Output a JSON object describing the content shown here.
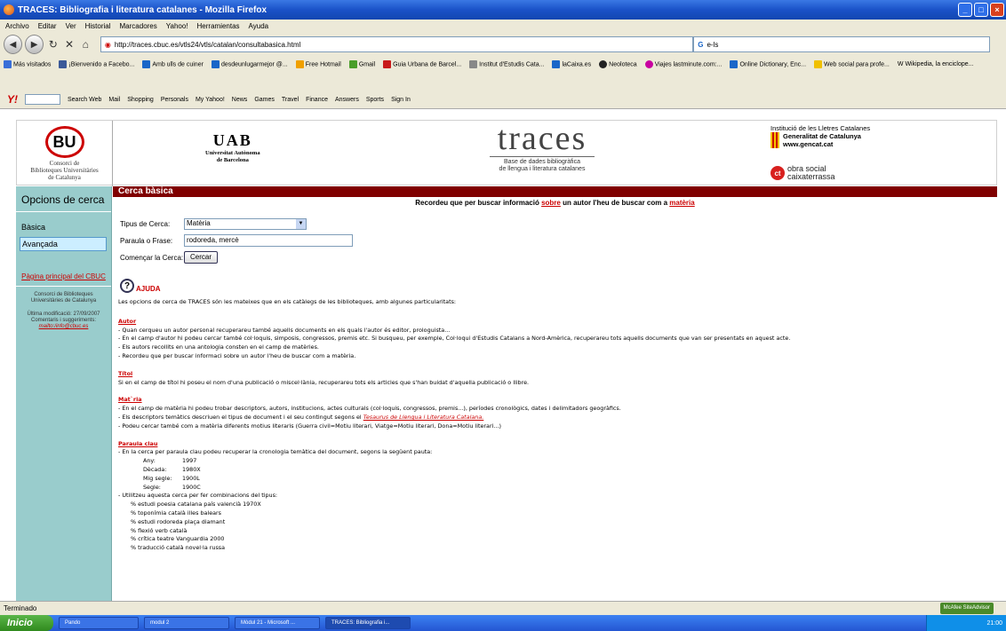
{
  "window": {
    "title": "TRACES: Bibliografia i literatura catalanes - Mozilla Firefox",
    "controls": [
      "_",
      "□",
      "×"
    ]
  },
  "menu": [
    "Archivo",
    "Editar",
    "Ver",
    "Historial",
    "Marcadores",
    "Yahoo!",
    "Herramientas",
    "Ayuda"
  ],
  "nav": {
    "url": "http://traces.cbuc.es/vtls24/vtls/catalan/consultabasica.html",
    "search_value": "e-ls"
  },
  "bookmarks": [
    {
      "label": "Más visitados",
      "color": "#3a6fd8"
    },
    {
      "label": "¡Bienvenido a Facebo...",
      "color": "#3b5998"
    },
    {
      "label": "Amb ulls de cuiner",
      "color": "#1a66c8"
    },
    {
      "label": "desdeunlugarmejor @...",
      "color": "#1a66c8"
    },
    {
      "label": "Free Hotmail",
      "color": "#f0a000"
    },
    {
      "label": "Gmail",
      "color": "#4a9e2a"
    },
    {
      "label": "Guia Urbana de Barcel...",
      "color": "#c81a1a"
    },
    {
      "label": "Institut d'Estudis Cata...",
      "color": "#888888"
    },
    {
      "label": "laCaixa.es",
      "color": "#1a66c8"
    },
    {
      "label": "Neoloteca",
      "color": "#222222"
    },
    {
      "label": "Viajes lastminute.com:...",
      "color": "#c800a0"
    },
    {
      "label": "Online Dictionary, Enc...",
      "color": "#1a66c8"
    },
    {
      "label": "Web social para profe...",
      "color": "#f0c000"
    },
    {
      "label": "Wikipedia, la enciclope...",
      "color": "#555555"
    }
  ],
  "yahoo_toolbar": [
    "Search Web",
    "Mail",
    "Shopping",
    "Personals",
    "My Yahoo!",
    "News",
    "Games",
    "Travel",
    "Finance",
    "Answers",
    "Sports",
    "Sign In"
  ],
  "header": {
    "bu_logo": "BU",
    "bu_text": [
      "Consorci de",
      "Biblioteques Universitàries",
      "de Catalunya"
    ],
    "uab_logo": "UAB",
    "uab_text": [
      "Universitat Autònoma",
      "de Barcelona"
    ],
    "traces_logo": "traces",
    "traces_sub": [
      "Base de dades bibliogràfica",
      "de llengua i literatura catalanes"
    ],
    "iletres": "Institució de les Lletres Catalanes",
    "gencat": [
      "Generalitat de Catalunya",
      "www.gencat.cat"
    ],
    "obra_social": [
      "obra social",
      "caixaterrassa"
    ]
  },
  "left_panel": {
    "title": "Opcions de cerca",
    "options": [
      "Bàsica",
      "Avançada"
    ],
    "link": "Pàgina principal del CBUC",
    "org": [
      "Consorci de Biblioteques",
      "Universitàries de Catalunya"
    ],
    "modified": "Última modificació: 27/09/2007",
    "comments": "Comentaris i suggeriments:",
    "mail": "mailto:/info@cbuc.es"
  },
  "main": {
    "bar_title": "Cerca bàsica",
    "notice_pre": "Recordeu que per buscar informació ",
    "notice_link1": "sobre",
    "notice_mid": " un autor l'heu de buscar com a ",
    "notice_link2": "matèria",
    "form": {
      "tipus_label": "Tipus de Cerca:",
      "tipus_value": "Matèria",
      "paraula_label": "Paraula o Frase:",
      "paraula_value": "rodoreda, mercè",
      "comencar_label": "Començar la Cerca:",
      "cercar_button": "Cercar"
    },
    "ajuda": "AJUDA",
    "intro": "Les opcions de cerca de TRACES són les mateixes que en els catàlegs de les biblioteques, amb algunes particularitats:"
  },
  "help": {
    "autor": {
      "heading": "Autor",
      "lines": [
        "- Quan cerqueu un autor personal recuperareu també aquells documents en els quals l'autor és editor, prologuista...",
        "- En el camp d'autor hi podeu cercar també col·loquis, simposis, congressos, premis etc. Si busqueu, per exemple, Col·loqui   d'Estudis Catalans a Nord-Amèrica, recuperareu tots aquells documents que van ser presentats en aquest acte.",
        "- Els autors recollits en una antologia consten en el camp de matèries.",
        "- Recordeu que per buscar informaci sobre un autor l'heu de buscar com a matèria."
      ]
    },
    "titol": {
      "heading": "Títol",
      "lines": [
        "Si en el camp de títol hi poseu el nom d'una publicació o miscel·lània, recuperareu tots els articles que s'han buidat d'aquella publicació o llibre."
      ]
    },
    "materia": {
      "heading": "Mat`ria",
      "lines": [
        "- En el camp de matèria hi podeu trobar descriptors, autors, institucions, actes culturals (col·loquis, congressos, premis...), períodes cronològics, dates i delimitadors geogràfics.",
        "- Els descriptors temàtics descriuen el tipus de document i el seu contingut segons el ",
        "- Podeu cercar també com a matèria diferents motius literaris (Guerra civil=Motiu literari, Viatge=Motiu literari, Dona=Motiu literari...)"
      ],
      "tesaurus_link": "Tesaurus de Llengua i Literatura Catalana."
    },
    "paraula": {
      "heading": "Paraula clau",
      "lines": [
        "- En la cerca per paraula clau podeu recuperar la cronologia temàtica del document, segons la següent pauta:"
      ],
      "pauta": [
        [
          "Any:",
          "1997"
        ],
        [
          "Dècada:",
          "1980X"
        ],
        [
          "Mig segle:",
          "1900L"
        ],
        [
          "Segle:",
          "1900C"
        ]
      ],
      "combi": "- Utilitzeu aquesta cerca per fer  combinacions del tipus:",
      "examples": [
        "% estudi poesia catalana país valencià 1970X",
        "% toponímia català illes balears",
        "% estudi rodoreda plaça diamant",
        "% flexió verb català",
        "% crítica teatre Vanguardia 2000",
        "% traducció català novel·la russa"
      ]
    }
  },
  "status": {
    "text": "Terminado",
    "mcafee": "McAfee SiteAdvisor"
  },
  "taskbar": {
    "start": "Inicio",
    "tasks": [
      "Pando",
      "modul 2",
      "Mòdul 21 - Microsoft ...",
      "TRACES: Bibliografia i..."
    ],
    "clock": "21:00"
  }
}
